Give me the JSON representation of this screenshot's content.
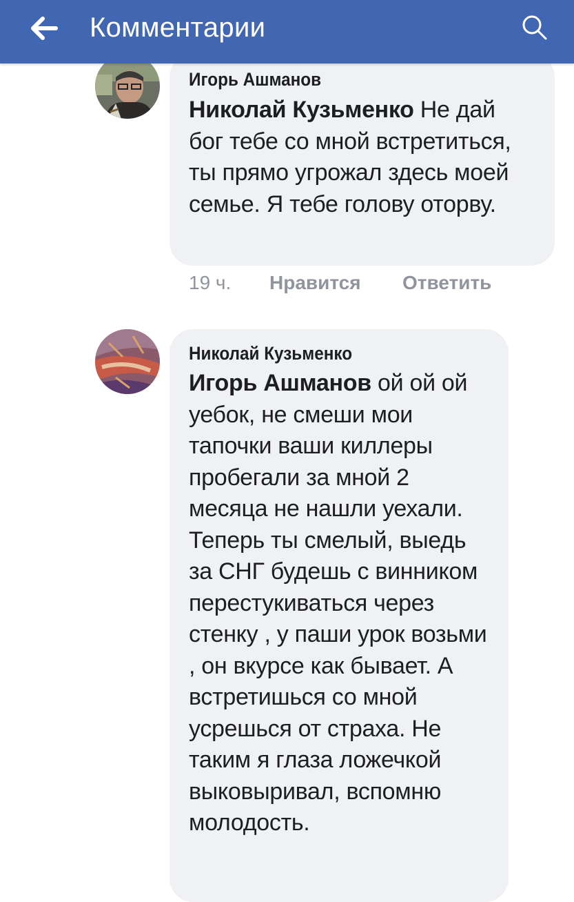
{
  "header": {
    "title": "Комментарии",
    "back_icon": "arrow-left-icon",
    "search_icon": "search-icon",
    "background": "#4267b2"
  },
  "comments": [
    {
      "author": "Игорь Ашманов",
      "mention": "Николай Кузьменко",
      "text": " Не дай бог тебе со мной встретиться, ты прямо угрожал здесь моей семье. Я тебе голову оторву.",
      "time": "19 ч.",
      "like_label": "Нравится",
      "reply_label": "Ответить"
    },
    {
      "author": "Николай Кузьменко",
      "mention": "Игорь Ашманов",
      "text": " ой ой ой уебок, не смеши мои тапочки ваши киллеры пробегали за мной 2 месяца не нашли уехали. Теперь ты смелый, выедь за СНГ будешь с винником перестукиваться через стенку , у паши урок возьми , он вкурсе как бывает. А встретишься со мной усрешься от страха. Не таким я глаза ложечкой выковыривал, вспомню молодость."
    }
  ]
}
